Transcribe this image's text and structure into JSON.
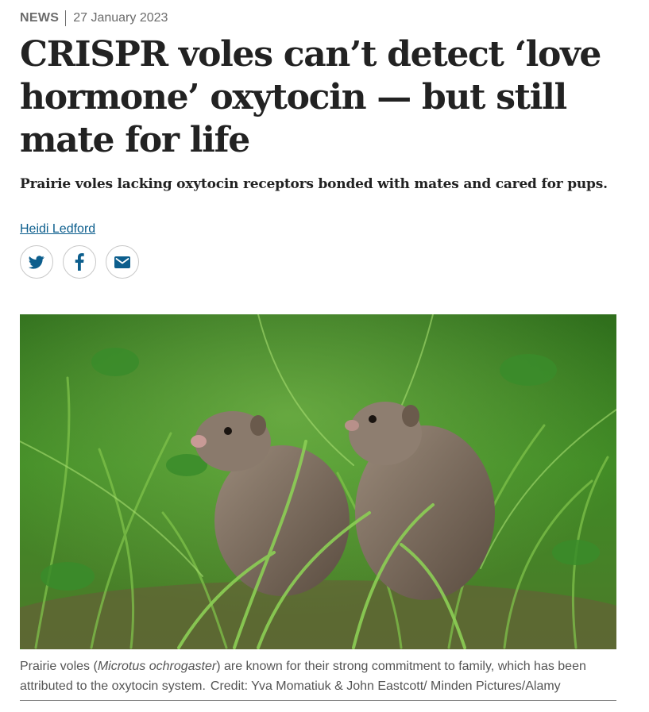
{
  "article": {
    "type": "NEWS",
    "date": "27 January 2023",
    "title": "CRISPR voles can’t detect ‘love hormone’ oxytocin — but still mate for life",
    "standfirst": "Prairie voles lacking oxytocin receptors bonded with mates and cared for pups.",
    "author": "Heidi Ledford"
  },
  "share": [
    {
      "icon": "twitter-icon"
    },
    {
      "icon": "facebook-icon"
    },
    {
      "icon": "email-icon"
    }
  ],
  "figure": {
    "caption_before": "Prairie voles (",
    "caption_species": "Microtus ochrogaster",
    "caption_after": ") are known for their strong commitment to family, which has been attributed to the oxytocin system.",
    "credit": "Credit: Yva Momatiuk & John Eastcott/ Minden Pictures/Alamy"
  },
  "colors": {
    "link": "#0c5e8d",
    "icon": "#0c5e8d",
    "text": "#222222",
    "muted": "#6b6b6b"
  }
}
